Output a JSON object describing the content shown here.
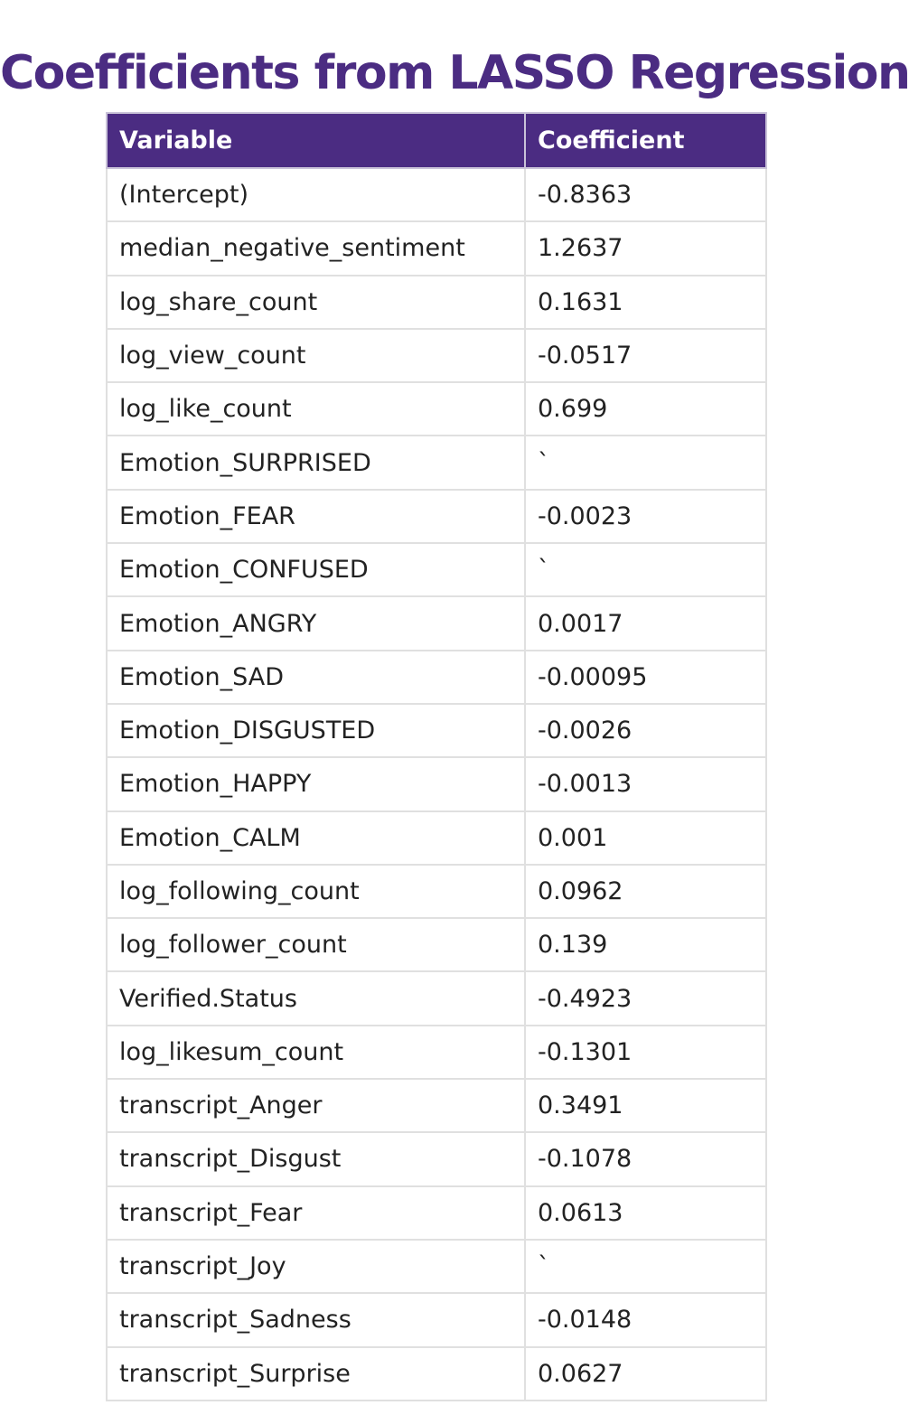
{
  "title": "Coefficients from LASSO Regression",
  "table": {
    "headers": [
      "Variable",
      "Coefficient"
    ],
    "rows": [
      {
        "variable": "(Intercept)",
        "coefficient": "-0.8363"
      },
      {
        "variable": "median_negative_sentiment",
        "coefficient": "1.2637"
      },
      {
        "variable": "log_share_count",
        "coefficient": "0.1631"
      },
      {
        "variable": "log_view_count",
        "coefficient": "-0.0517"
      },
      {
        "variable": "log_like_count",
        "coefficient": "0.699"
      },
      {
        "variable": "Emotion_SURPRISED",
        "coefficient": "`"
      },
      {
        "variable": "Emotion_FEAR",
        "coefficient": "-0.0023"
      },
      {
        "variable": "Emotion_CONFUSED",
        "coefficient": "`"
      },
      {
        "variable": "Emotion_ANGRY",
        "coefficient": "0.0017"
      },
      {
        "variable": "Emotion_SAD",
        "coefficient": "-0.00095"
      },
      {
        "variable": "Emotion_DISGUSTED",
        "coefficient": "-0.0026"
      },
      {
        "variable": "Emotion_HAPPY",
        "coefficient": "-0.0013"
      },
      {
        "variable": "Emotion_CALM",
        "coefficient": "0.001"
      },
      {
        "variable": "log_following_count",
        "coefficient": "0.0962"
      },
      {
        "variable": "log_follower_count",
        "coefficient": "0.139"
      },
      {
        "variable": "Verified.Status",
        "coefficient": "-0.4923"
      },
      {
        "variable": "log_likesum_count",
        "coefficient": "-0.1301"
      },
      {
        "variable": "transcript_Anger",
        "coefficient": "0.3491"
      },
      {
        "variable": "transcript_Disgust",
        "coefficient": "-0.1078"
      },
      {
        "variable": "transcript_Fear",
        "coefficient": "0.0613"
      },
      {
        "variable": "transcript_Joy",
        "coefficient": "`"
      },
      {
        "variable": "transcript_Sadness",
        "coefficient": "-0.0148"
      },
      {
        "variable": "transcript_Surprise",
        "coefficient": "0.0627"
      }
    ]
  },
  "colors": {
    "accent": "#4b2c82",
    "header_text": "#ffffff",
    "body_text": "#222222",
    "grid": "#e0e0e0"
  }
}
